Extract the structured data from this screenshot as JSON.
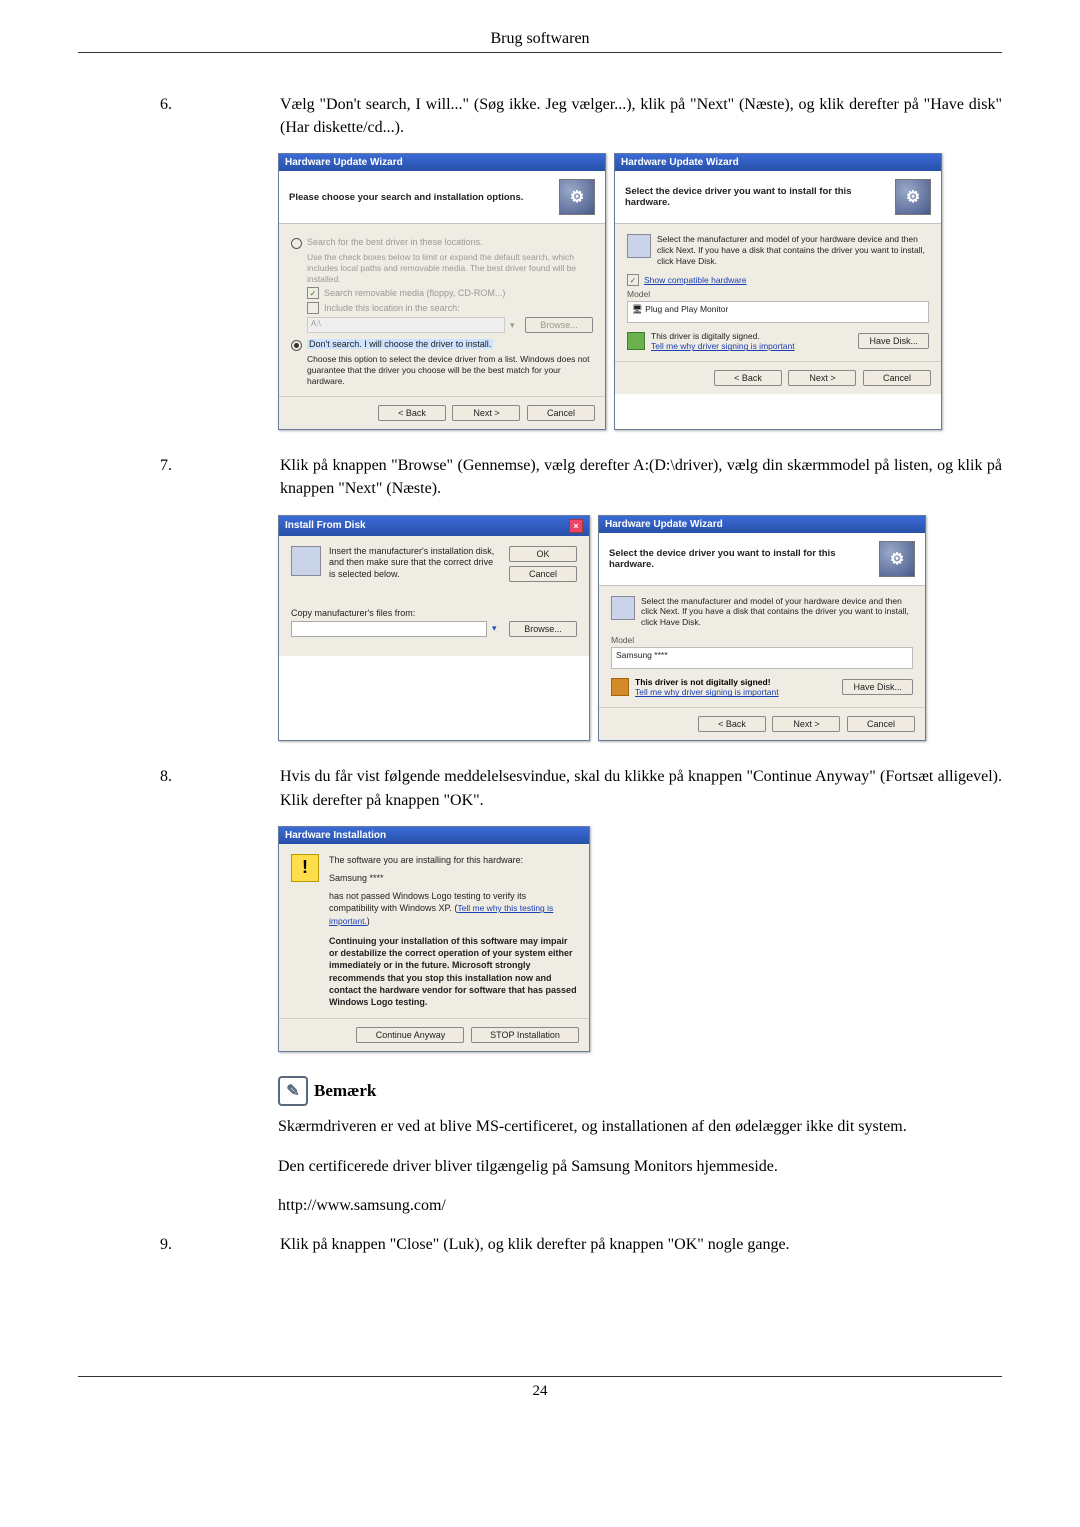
{
  "header": {
    "title": "Brug softwaren"
  },
  "steps": {
    "s6": {
      "num": "6.",
      "text": "Vælg \"Don't search, I will...\" (Søg ikke. Jeg vælger...), klik på \"Next\" (Næste), og klik derefter på \"Have disk\" (Har diskette/cd...)."
    },
    "s7": {
      "num": "7.",
      "text": "Klik på knappen \"Browse\" (Gennemse), vælg derefter A:(D:\\driver), vælg din skærmmodel på listen, og klik på knappen \"Next\" (Næste)."
    },
    "s8": {
      "num": "8.",
      "text": "Hvis du får vist følgende meddelelsesvindue, skal du klikke på knappen \"Continue Anyway\" (Fortsæt alligevel). Klik derefter på knappen \"OK\"."
    },
    "s9": {
      "num": "9.",
      "text": "Klik på knappen \"Close\" (Luk), og klik derefter på knappen \"OK\" nogle gange."
    }
  },
  "note": {
    "label": "Bemærk",
    "p1": "Skærmdriveren er ved at blive MS-certificeret, og installationen af den ødelægger ikke dit system.",
    "p2": "Den certificerede driver bliver tilgængelig på Samsung Monitors hjemmeside.",
    "p3": "http://www.samsung.com/"
  },
  "dlg": {
    "huw_title": "Hardware Update Wizard",
    "ifd_title": "Install From Disk",
    "hi_title": "Hardware Installation",
    "back_btn": "< Back",
    "next_btn": "Next >",
    "cancel_btn": "Cancel",
    "ok_btn": "OK",
    "browse_btn": "Browse...",
    "have_disk_btn": "Have Disk...",
    "continue_btn": "Continue Anyway",
    "stop_btn": "STOP Installation",
    "d6a": {
      "header": "Please choose your search and installation options.",
      "radio1": "Search for the best driver in these locations.",
      "radio1_sub": "Use the check boxes below to limit or expand the default search, which includes local paths and removable media. The best driver found will be installed.",
      "chk1": "Search removable media (floppy, CD-ROM...)",
      "chk2": "Include this location in the search:",
      "path": "A:\\",
      "radio2": "Don't search. I will choose the driver to install.",
      "radio2_sub": "Choose this option to select the device driver from a list. Windows does not guarantee that the driver you choose will be the best match for your hardware."
    },
    "d6b": {
      "header": "Select the device driver you want to install for this hardware.",
      "intro": "Select the manufacturer and model of your hardware device and then click Next. If you have a disk that contains the driver you want to install, click Have Disk.",
      "show_compat": "Show compatible hardware",
      "model_label": "Model",
      "model_value": "Plug and Play Monitor",
      "signed": "This driver is digitally signed.",
      "signed_link": "Tell me why driver signing is important"
    },
    "d7a": {
      "msg": "Insert the manufacturer's installation disk, and then make sure that the correct drive is selected below.",
      "copy_label": "Copy manufacturer's files from:"
    },
    "d7b": {
      "header": "Select the device driver you want to install for this hardware.",
      "intro": "Select the manufacturer and model of your hardware device and then click Next. If you have a disk that contains the driver you want to install, click Have Disk.",
      "model_label": "Model",
      "model_value": "Samsung ****",
      "notsigned": "This driver is not digitally signed!",
      "signed_link": "Tell me why driver signing is important"
    },
    "d8": {
      "line1": "The software you are installing for this hardware:",
      "device": "Samsung ****",
      "line2a": "has not passed Windows Logo testing to verify its compatibility with Windows XP. (",
      "line2link": "Tell me why this testing is important.",
      "line2b": ")",
      "warn": "Continuing your installation of this software may impair or destabilize the correct operation of your system either immediately or in the future. Microsoft strongly recommends that you stop this installation now and contact the hardware vendor for software that has passed Windows Logo testing."
    }
  },
  "footer": {
    "pagenum": "24"
  }
}
